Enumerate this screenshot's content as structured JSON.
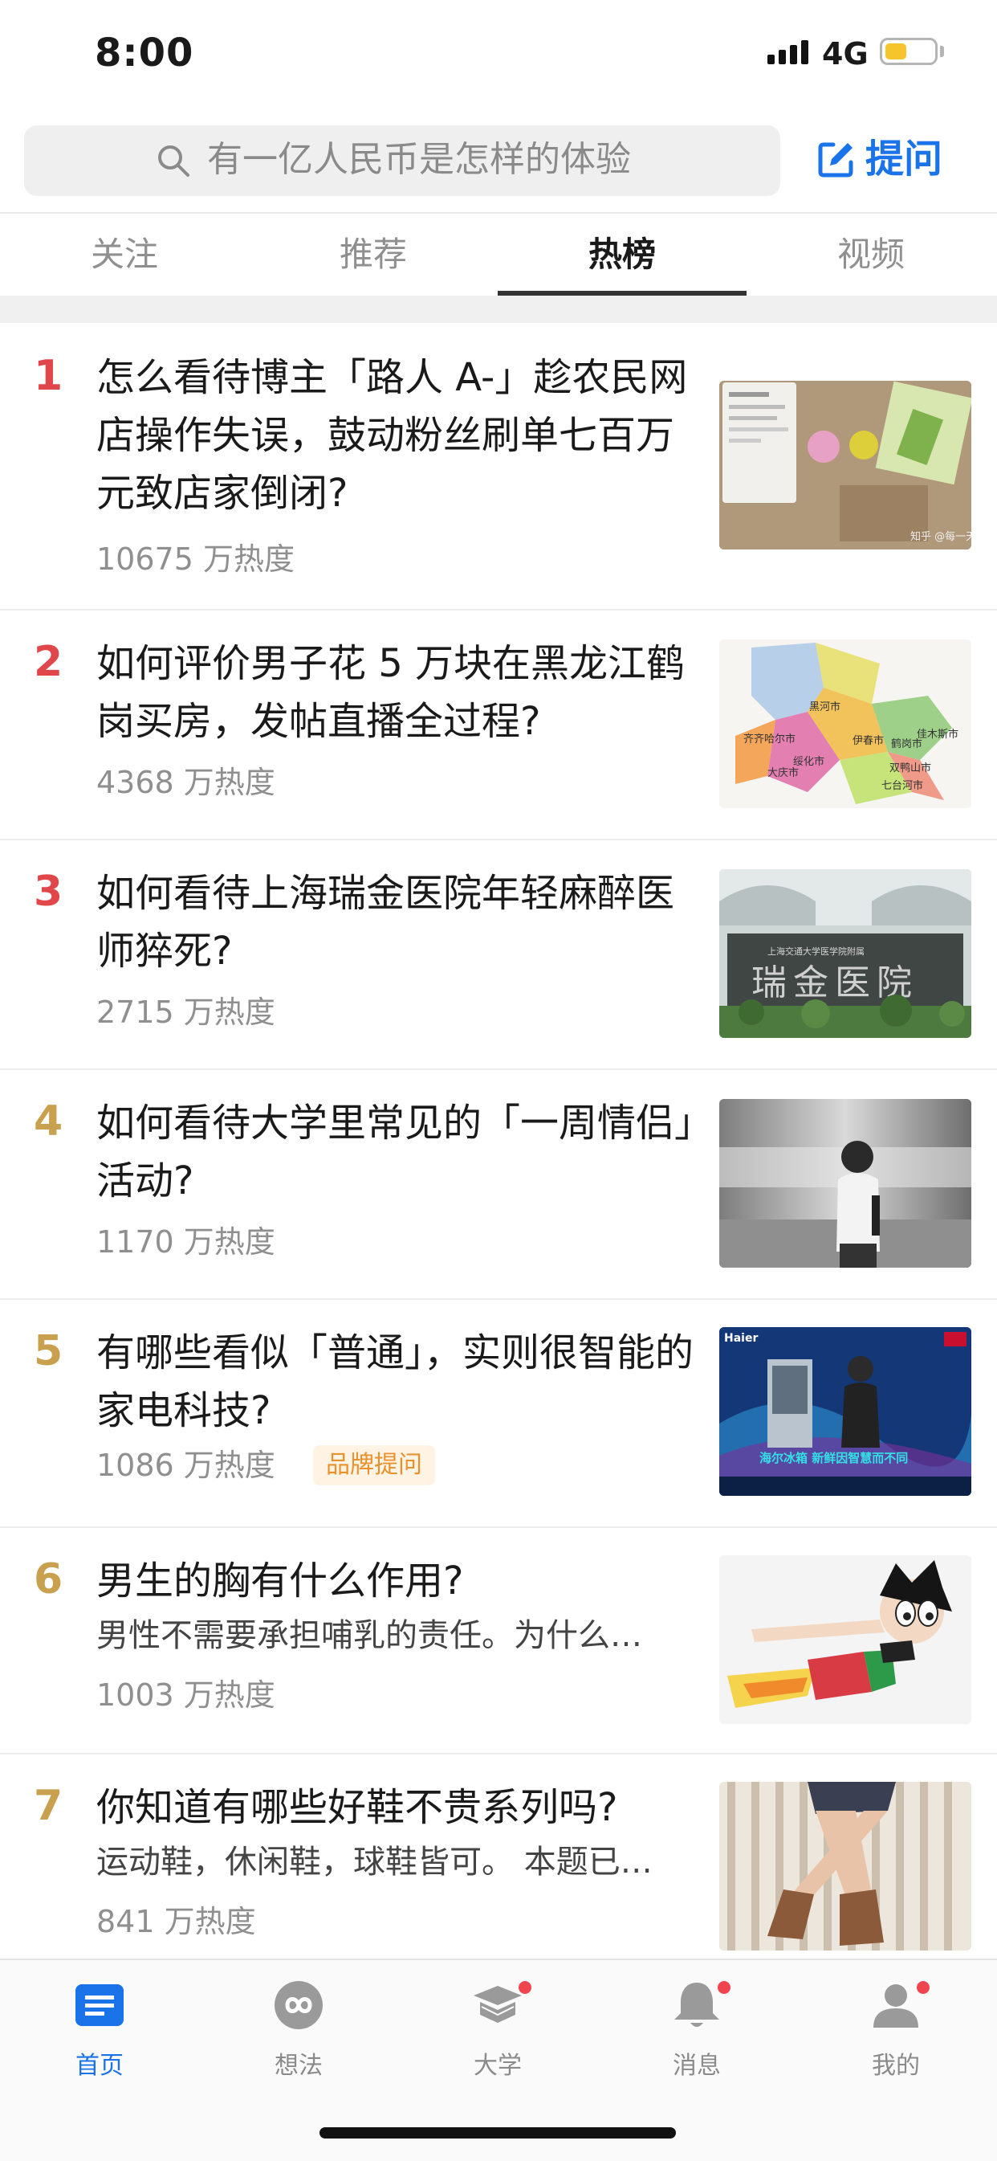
{
  "status": {
    "time": "8:00",
    "network": "4G",
    "battery_level": 0.45
  },
  "search": {
    "placeholder": "有一亿人民币是怎样的体验"
  },
  "ask_button": {
    "label": "提问"
  },
  "tabs": [
    {
      "label": "关注"
    },
    {
      "label": "推荐"
    },
    {
      "label": "热榜",
      "active": true
    },
    {
      "label": "视频"
    }
  ],
  "hot_list": [
    {
      "rank": "1",
      "rank_color": "#e0464a",
      "title": "怎么看待博主「路人 A-」趁农民网店操作失误，鼓动粉丝刷单七百万元致店家倒闭?",
      "excerpt": "",
      "heat": "10675 万热度",
      "badge": ""
    },
    {
      "rank": "2",
      "rank_color": "#e0464a",
      "title": "如何评价男子花 5 万块在黑龙江鹤岗买房，发帖直播全过程?",
      "excerpt": "",
      "heat": "4368 万热度",
      "badge": ""
    },
    {
      "rank": "3",
      "rank_color": "#e0464a",
      "title": "如何看待上海瑞金医院年轻麻醉医师猝死?",
      "excerpt": "",
      "heat": "2715 万热度",
      "badge": ""
    },
    {
      "rank": "4",
      "rank_color": "#c9a04e",
      "title": "如何看待大学里常见的「一周情侣」活动?",
      "excerpt": "",
      "heat": "1170 万热度",
      "badge": ""
    },
    {
      "rank": "5",
      "rank_color": "#c9a04e",
      "title": "有哪些看似「普通」，实则很智能的家电科技?",
      "excerpt": "",
      "heat": "1086 万热度",
      "badge": "品牌提问"
    },
    {
      "rank": "6",
      "rank_color": "#c9a04e",
      "title": "男生的胸有什么作用?",
      "excerpt": "男性不需要承担哺乳的责任。为什么…",
      "heat": "1003 万热度",
      "badge": ""
    },
    {
      "rank": "7",
      "rank_color": "#c9a04e",
      "title": "你知道有哪些好鞋不贵系列吗?",
      "excerpt": "运动鞋，休闲鞋，球鞋皆可。 本题已…",
      "heat": "841 万热度",
      "badge": ""
    }
  ],
  "thumbs": {
    "t1_watermark": "知乎 @每一天",
    "t2_map_labels": [
      "黑河市",
      "齐齐哈尔市",
      "绥化市",
      "伊春市",
      "鹤岗市",
      "佳木斯市",
      "双鸭山市",
      "大庆市",
      "七台河市"
    ],
    "t3_sign": "瑞金医院",
    "t3_subsign": "上海交通大学医学院附属",
    "t5_brand": "Haier",
    "t5_slogan": "海尔冰箱 新鲜因智慧而不同"
  },
  "tabbar": [
    {
      "label": "首页",
      "active": true
    },
    {
      "label": "想法"
    },
    {
      "label": "大学",
      "dot": true
    },
    {
      "label": "消息",
      "dot": true
    },
    {
      "label": "我的",
      "dot": true
    }
  ],
  "colors": {
    "accent": "#1a73e8",
    "hot_red": "#e0464a",
    "hot_gold": "#c9a04e",
    "badge_dot": "#f0454f"
  }
}
